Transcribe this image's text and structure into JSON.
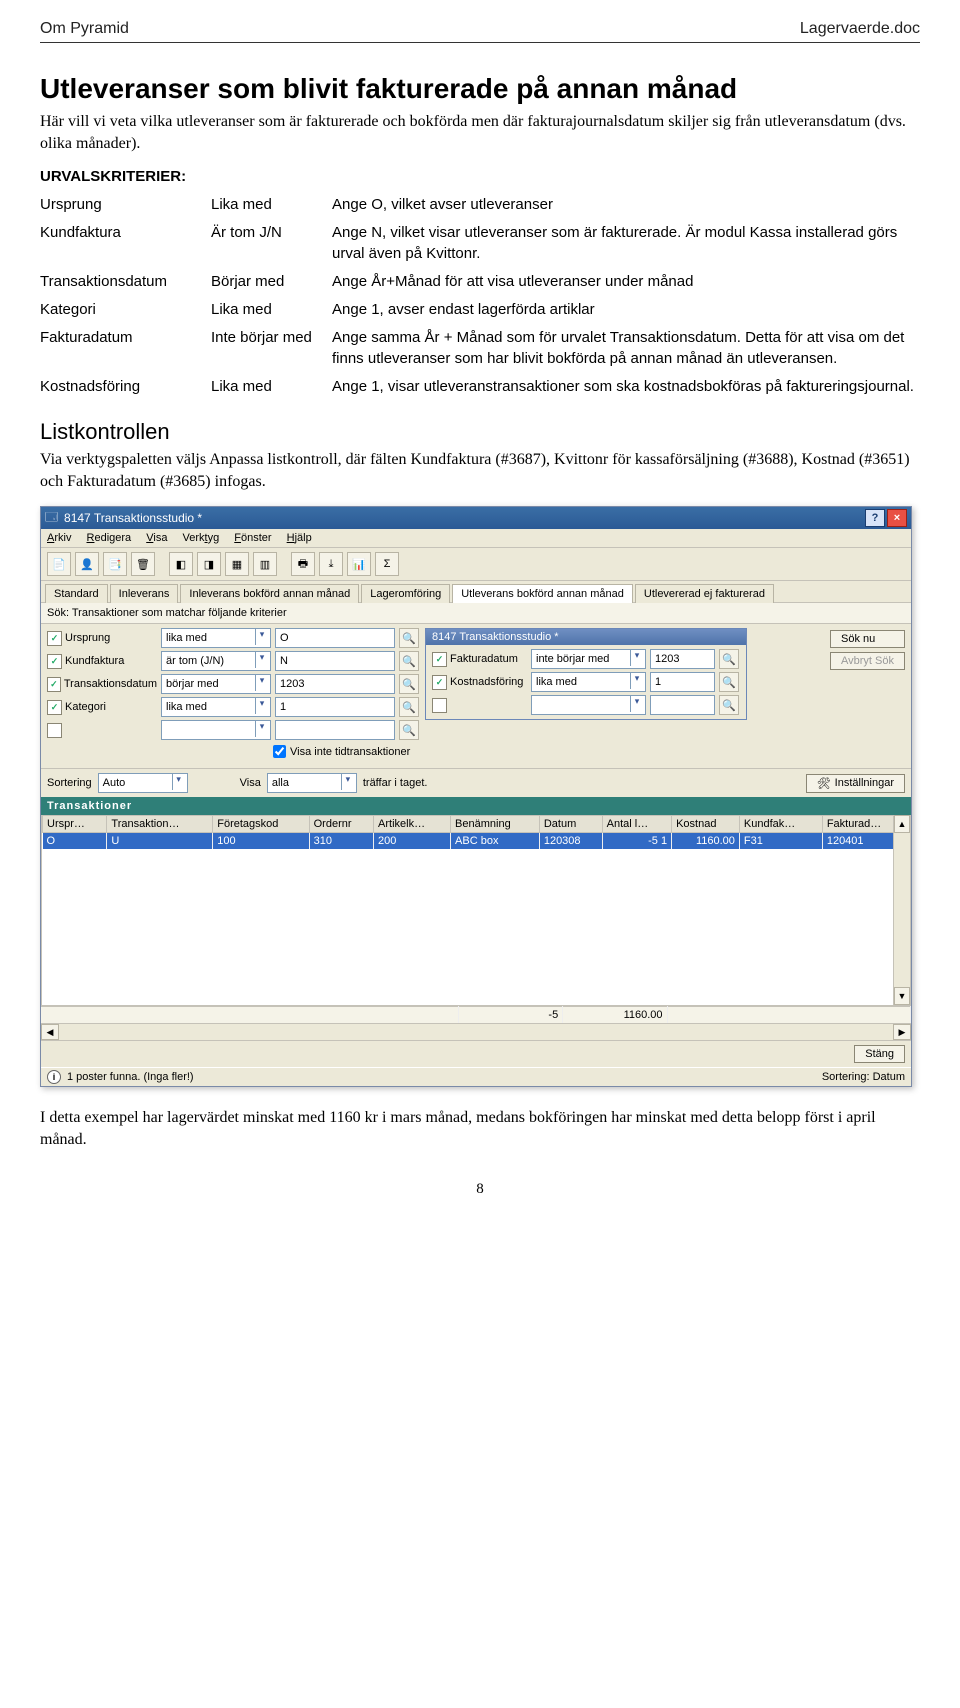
{
  "header": {
    "left": "Om Pyramid",
    "right": "Lagervaerde.doc"
  },
  "title": "Utleveranser som blivit fakturerade på annan månad",
  "intro": "Här vill vi veta vilka utleveranser som är fakturerade och bokförda men där fakturajournalsdatum skiljer sig från utleveransdatum (dvs. olika månader).",
  "criteria_heading": "URVALSKRITERIER:",
  "criteria": [
    {
      "f": "Ursprung",
      "op": "Lika med",
      "desc": "Ange O, vilket avser utleveranser"
    },
    {
      "f": "Kundfaktura",
      "op": "Är tom J/N",
      "desc": "Ange N, vilket visar utleveranser som är fakturerade. Är modul Kassa installerad görs urval även på Kvittonr."
    },
    {
      "f": "Transaktionsdatum",
      "op": "Börjar med",
      "desc": "Ange År+Månad för att visa utleveranser under månad"
    },
    {
      "f": "Kategori",
      "op": "Lika med",
      "desc": "Ange 1, avser endast lagerförda artiklar"
    },
    {
      "f": "Fakturadatum",
      "op": "Inte börjar med",
      "desc": "Ange samma År + Månad som för urvalet Transaktionsdatum. Detta för att visa om det finns utleveranser som har blivit bokförda på annan månad än utleveransen."
    },
    {
      "f": "Kostnadsföring",
      "op": "Lika med",
      "desc": "Ange 1, visar utleveranstransaktioner som ska kostnadsbokföras på faktureringsjournal."
    }
  ],
  "list_heading": "Listkontrollen",
  "list_para": "Via verktygspaletten väljs Anpassa listkontroll, där fälten Kundfaktura (#3687), Kvittonr för kassaförsäljning (#3688), Kostnad (#3651) och Fakturadatum (#3685) infogas.",
  "shot": {
    "title": "8147 Transaktionsstudio *",
    "menus": [
      "Arkiv",
      "Redigera",
      "Visa",
      "Verktyg",
      "Fönster",
      "Hjälp"
    ],
    "tabs": [
      "Standard",
      "Inleverans",
      "Inleverans bokförd annan månad",
      "Lageromföring",
      "Utleverans bokförd annan månad",
      "Utlevererad ej fakturerad"
    ],
    "tab_active": 4,
    "sok_label": "Sök:",
    "sok_text": "Transaktioner som matchar följande kriterier",
    "left_filters": [
      {
        "name": "Ursprung",
        "op": "lika med",
        "val": "O"
      },
      {
        "name": "Kundfaktura",
        "op": "är tom (J/N)",
        "val": "N"
      },
      {
        "name": "Transaktionsdatum",
        "op": "börjar med",
        "val": "1203"
      },
      {
        "name": "Kategori",
        "op": "lika med",
        "val": "1"
      },
      {
        "name": "",
        "op": "",
        "val": ""
      }
    ],
    "inner_title": "8147 Transaktionsstudio *",
    "inner_filters": [
      {
        "name": "Fakturadatum",
        "op": "inte börjar med",
        "val": "1203"
      },
      {
        "name": "Kostnadsföring",
        "op": "lika med",
        "val": "1"
      },
      {
        "name": "",
        "op": "",
        "val": ""
      }
    ],
    "checkbox_label": "Visa inte tidtransaktioner",
    "sok_nu": "Sök nu",
    "avbryt": "Avbryt Sök",
    "sort_label": "Sortering",
    "sort_val": "Auto",
    "visa_label": "Visa",
    "visa_val": "alla",
    "visa_suffix": "träffar i taget.",
    "instal": "Inställningar",
    "grid_title": "Transaktioner",
    "columns": [
      "Urspr…",
      "Transaktion…",
      "Företagskod",
      "Ordernr",
      "Artikelk…",
      "Benämning",
      "Datum",
      "Antal l…",
      "Kostnad",
      "Kundfak…",
      "Fakturad…"
    ],
    "row": [
      "O",
      "U",
      "100",
      "310",
      "200",
      "ABC box",
      "120308",
      "-5 1",
      "1160.00",
      "F31",
      "120401"
    ],
    "totals": {
      "antal": "-5",
      "kostnad": "1160.00"
    },
    "stang": "Stäng",
    "status_left": "1 poster funna. (Inga fler!)",
    "status_right": "Sortering: Datum"
  },
  "closing": "I detta exempel har lagervärdet minskat med 1160 kr i mars månad, medans bokföringen har minskat med detta belopp först i april månad.",
  "pagenum": "8"
}
